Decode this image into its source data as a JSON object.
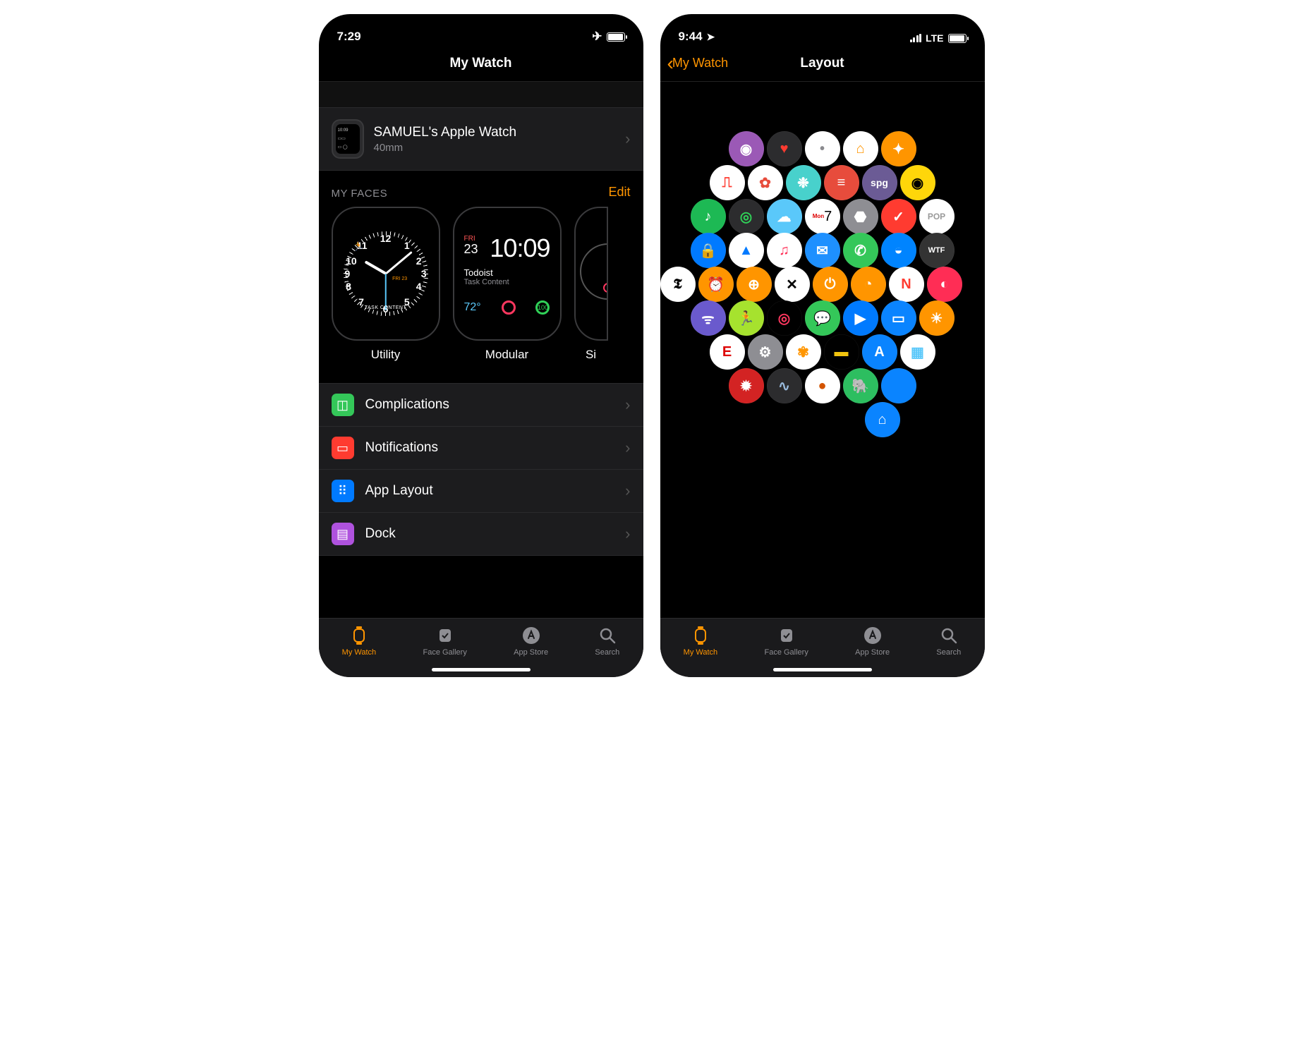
{
  "left": {
    "status": {
      "time": "7:29",
      "airplane": true
    },
    "header": {
      "title": "My Watch"
    },
    "watch_row": {
      "name": "SAMUEL's Apple Watch",
      "size": "40mm",
      "thumb_time": "10:09"
    },
    "faces_section": {
      "label": "MY FACES",
      "edit": "Edit"
    },
    "faces": [
      {
        "name": "Utility",
        "type": "analog",
        "task": "TASK CONTENT",
        "date": "FRI 23"
      },
      {
        "name": "Modular",
        "type": "modular",
        "time": "10:09",
        "date_day": "FRI",
        "date_num": "23",
        "mid_title": "Todoist",
        "mid_sub": "Task Content",
        "temp": "72°"
      },
      {
        "name": "Si",
        "type": "peek"
      }
    ],
    "menu": [
      {
        "icon_name": "complications-icon",
        "color": "#34c759",
        "label": "Complications"
      },
      {
        "icon_name": "notifications-icon",
        "color": "#ff3b30",
        "label": "Notifications"
      },
      {
        "icon_name": "app-layout-icon",
        "color": "#007aff",
        "label": "App Layout"
      },
      {
        "icon_name": "dock-icon",
        "color": "#af52de",
        "label": "Dock"
      }
    ]
  },
  "right": {
    "status": {
      "time": "9:44",
      "carrier": "LTE"
    },
    "header": {
      "back": "My Watch",
      "title": "Layout"
    },
    "apps": [
      {
        "name": "podcasts",
        "bg": "#9b59b6",
        "sym": "◉",
        "row": 0,
        "col": 0
      },
      {
        "name": "heart",
        "bg": "#2c2c2e",
        "sym": "♥",
        "fg": "#ff3b30",
        "row": 0,
        "col": 1
      },
      {
        "name": "contacts",
        "bg": "#ffffff",
        "sym": "•",
        "fg": "#8a8a8e",
        "row": 0,
        "col": 2
      },
      {
        "name": "home",
        "bg": "#ffffff",
        "sym": "⌂",
        "fg": "#ff9500",
        "row": 0,
        "col": 3
      },
      {
        "name": "workout",
        "bg": "#ff9500",
        "sym": "✦",
        "row": 0,
        "col": 4
      },
      {
        "name": "ecg",
        "bg": "#ffffff",
        "sym": "⎍",
        "fg": "#ff3b30",
        "row": 1,
        "col": 0
      },
      {
        "name": "breathe",
        "bg": "#ffffff",
        "sym": "✿",
        "fg": "#e74c3c",
        "row": 1,
        "col": 1
      },
      {
        "name": "mind",
        "bg": "#48d1cc",
        "sym": "❉",
        "row": 1,
        "col": 2
      },
      {
        "name": "todoist",
        "bg": "#e74c3c",
        "sym": "≡",
        "row": 1,
        "col": 3
      },
      {
        "name": "spg",
        "bg": "#6b5b95",
        "sym": "spg",
        "fs": 14,
        "row": 1,
        "col": 4
      },
      {
        "name": "camera",
        "bg": "#ffd60a",
        "sym": "◉",
        "fg": "#000",
        "row": 1,
        "col": 5
      },
      {
        "name": "spotify",
        "bg": "#1db954",
        "sym": "♪",
        "row": 2,
        "col": 0
      },
      {
        "name": "findmy",
        "bg": "#2c2c2e",
        "sym": "◎",
        "fg": "#30d158",
        "row": 2,
        "col": 1
      },
      {
        "name": "weather",
        "bg": "#5ac8fa",
        "sym": "☁",
        "row": 2,
        "col": 2
      },
      {
        "name": "calendar",
        "bg": "#ffffff",
        "sym": "7",
        "fg": "#000",
        "fs": 18,
        "row": 2,
        "col": 3,
        "top": "Mon"
      },
      {
        "name": "grey",
        "bg": "#8e8e93",
        "sym": "⬣",
        "row": 2,
        "col": 4
      },
      {
        "name": "things",
        "bg": "#ff3b30",
        "sym": "✓",
        "row": 2,
        "col": 5
      },
      {
        "name": "pop",
        "bg": "#ffffff",
        "sym": "POP",
        "fg": "#999",
        "fs": 12,
        "row": 2,
        "col": 6
      },
      {
        "name": "authenticator",
        "bg": "#007aff",
        "sym": "🔒",
        "row": 3,
        "col": 0
      },
      {
        "name": "maps-arrow",
        "bg": "#ffffff",
        "sym": "▲",
        "fg": "#007aff",
        "row": 3,
        "col": 1
      },
      {
        "name": "music",
        "bg": "#ffffff",
        "sym": "♫",
        "fg": "#ff2d55",
        "row": 3,
        "col": 2
      },
      {
        "name": "mail",
        "bg": "#1e90ff",
        "sym": "✉",
        "row": 3,
        "col": 3
      },
      {
        "name": "phone",
        "bg": "#34c759",
        "sym": "✆",
        "row": 3,
        "col": 4
      },
      {
        "name": "messenger",
        "bg": "#0084ff",
        "sym": "◒",
        "row": 3,
        "col": 5
      },
      {
        "name": "wtf",
        "bg": "#333333",
        "sym": "WTF",
        "fs": 11,
        "row": 3,
        "col": 6
      },
      {
        "name": "nyt",
        "bg": "#ffffff",
        "sym": "𝕿",
        "fg": "#000",
        "row": 4,
        "col": 0
      },
      {
        "name": "alarm",
        "bg": "#ff9500",
        "sym": "⏰",
        "row": 4,
        "col": 1
      },
      {
        "name": "world",
        "bg": "#ff9500",
        "sym": "⊕",
        "row": 4,
        "col": 2
      },
      {
        "name": "clock",
        "bg": "#ffffff",
        "sym": "✕",
        "fg": "#000",
        "row": 4,
        "col": 3
      },
      {
        "name": "timer",
        "bg": "#ff9500",
        "sym": "⏻",
        "row": 4,
        "col": 4
      },
      {
        "name": "stopwatch",
        "bg": "#ff9500",
        "sym": "◔",
        "row": 4,
        "col": 5
      },
      {
        "name": "news",
        "bg": "#ffffff",
        "sym": "N",
        "fg": "#ff3b30",
        "row": 4,
        "col": 6
      },
      {
        "name": "pink",
        "bg": "#ff2d55",
        "sym": "◐",
        "row": 4,
        "col": 7
      },
      {
        "name": "remote",
        "bg": "#6a5acd",
        "sym": "ᯤ",
        "row": 5,
        "col": 0
      },
      {
        "name": "fitness",
        "bg": "#a6e22e",
        "sym": "🏃",
        "fg": "#000",
        "row": 5,
        "col": 1
      },
      {
        "name": "activity",
        "bg": "#000000",
        "sym": "◎",
        "fg": "#ff375f",
        "row": 5,
        "col": 2
      },
      {
        "name": "messages",
        "bg": "#34c759",
        "sym": "💬",
        "row": 5,
        "col": 3
      },
      {
        "name": "play",
        "bg": "#007aff",
        "sym": "▶",
        "row": 5,
        "col": 4
      },
      {
        "name": "keynote",
        "bg": "#0a84ff",
        "sym": "▭",
        "row": 5,
        "col": 5
      },
      {
        "name": "darksky",
        "bg": "#ff9500",
        "sym": "☀",
        "row": 5,
        "col": 6
      },
      {
        "name": "espn",
        "bg": "#ffffff",
        "sym": "E",
        "fg": "#d00",
        "row": 6,
        "col": 0
      },
      {
        "name": "settings",
        "bg": "#8e8e93",
        "sym": "⚙",
        "row": 6,
        "col": 1
      },
      {
        "name": "photos",
        "bg": "#ffffff",
        "sym": "✾",
        "fg": "#ff9500",
        "row": 6,
        "col": 2
      },
      {
        "name": "wallet",
        "bg": "#000",
        "sym": "▬",
        "fg": "#f1c40f",
        "row": 6,
        "col": 3
      },
      {
        "name": "appstore",
        "bg": "#0a84ff",
        "sym": "A",
        "row": 6,
        "col": 4
      },
      {
        "name": "shortcuts",
        "bg": "#ffffff",
        "sym": "▦",
        "fg": "#5ac8fa",
        "row": 6,
        "col": 5
      },
      {
        "name": "yelp",
        "bg": "#d32323",
        "sym": "✹",
        "row": 7,
        "col": 0
      },
      {
        "name": "stocks",
        "bg": "#2c2c2e",
        "sym": "∿",
        "fg": "#9bd",
        "row": 7,
        "col": 1
      },
      {
        "name": "streaks",
        "bg": "#ffffff",
        "sym": "●",
        "fg": "#d35400",
        "row": 7,
        "col": 2
      },
      {
        "name": "evernote",
        "bg": "#2dbe60",
        "sym": "🐘",
        "row": 7,
        "col": 3
      },
      {
        "name": "blue",
        "bg": "#0a84ff",
        "sym": "",
        "row": 7,
        "col": 4
      },
      {
        "name": "homeapp",
        "bg": "#0a84ff",
        "sym": "⌂",
        "row": 8,
        "col": 0
      }
    ]
  },
  "tabs": [
    {
      "icon_name": "my-watch-tab-icon",
      "label": "My Watch",
      "active": true
    },
    {
      "icon_name": "face-gallery-tab-icon",
      "label": "Face Gallery",
      "active": false
    },
    {
      "icon_name": "app-store-tab-icon",
      "label": "App Store",
      "active": false
    },
    {
      "icon_name": "search-tab-icon",
      "label": "Search",
      "active": false
    }
  ]
}
